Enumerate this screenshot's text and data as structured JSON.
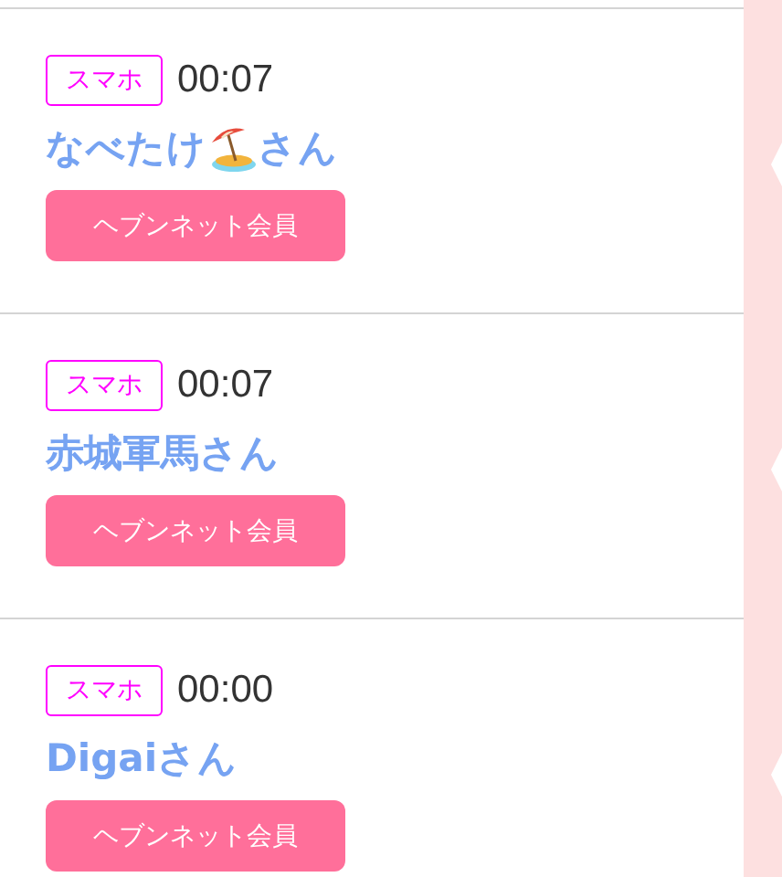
{
  "entries": [
    {
      "device": "スマホ",
      "time": "00:07",
      "name_parts": [
        {
          "kind": "text",
          "text": "なべたけ"
        },
        {
          "kind": "icon"
        },
        {
          "kind": "text",
          "text": "さん"
        }
      ],
      "member": "ヘブンネット会員"
    },
    {
      "device": "スマホ",
      "time": "00:07",
      "name_parts": [
        {
          "kind": "text",
          "text": "赤城軍馬さん"
        }
      ],
      "member": "ヘブンネット会員"
    },
    {
      "device": "スマホ",
      "time": "00:00",
      "name_parts": [
        {
          "kind": "text",
          "text": "Digaiさん"
        }
      ],
      "member": "ヘブンネット会員"
    }
  ]
}
